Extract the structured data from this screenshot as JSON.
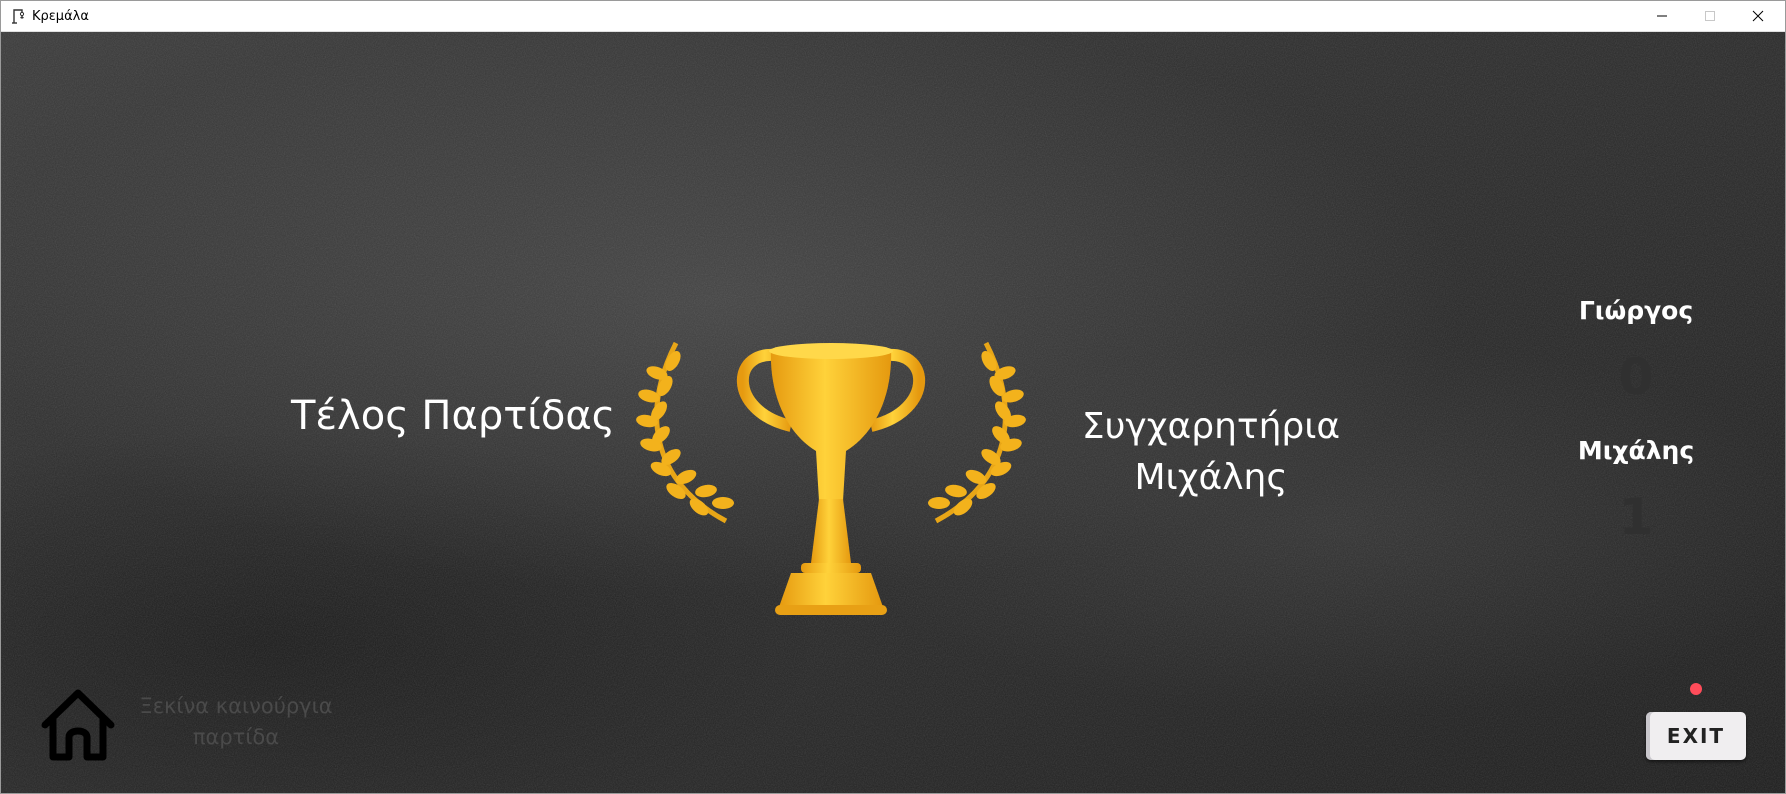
{
  "window": {
    "title": "Κρεμάλα"
  },
  "game_over": {
    "title": "Τέλος Παρτίδας",
    "congrats_line1": "Συγχαρητήρια",
    "congrats_line2": "Μιχάλης"
  },
  "scores": [
    {
      "name": "Γιώργος",
      "score": "0"
    },
    {
      "name": "Μιχάλης",
      "score": "1"
    }
  ],
  "bottom": {
    "new_game_line1": "Ξεκίνα καινούργια",
    "new_game_line2": "παρτίδα",
    "exit_label": "EXIT"
  },
  "icons": {
    "app": "hangman-icon",
    "home": "home-icon",
    "trophy": "trophy-icon"
  },
  "colors": {
    "background": "#2a2a2a",
    "trophy_gold": "#f2b21b",
    "score_dim": "#303030",
    "notification_dot": "#ff4c5a"
  }
}
